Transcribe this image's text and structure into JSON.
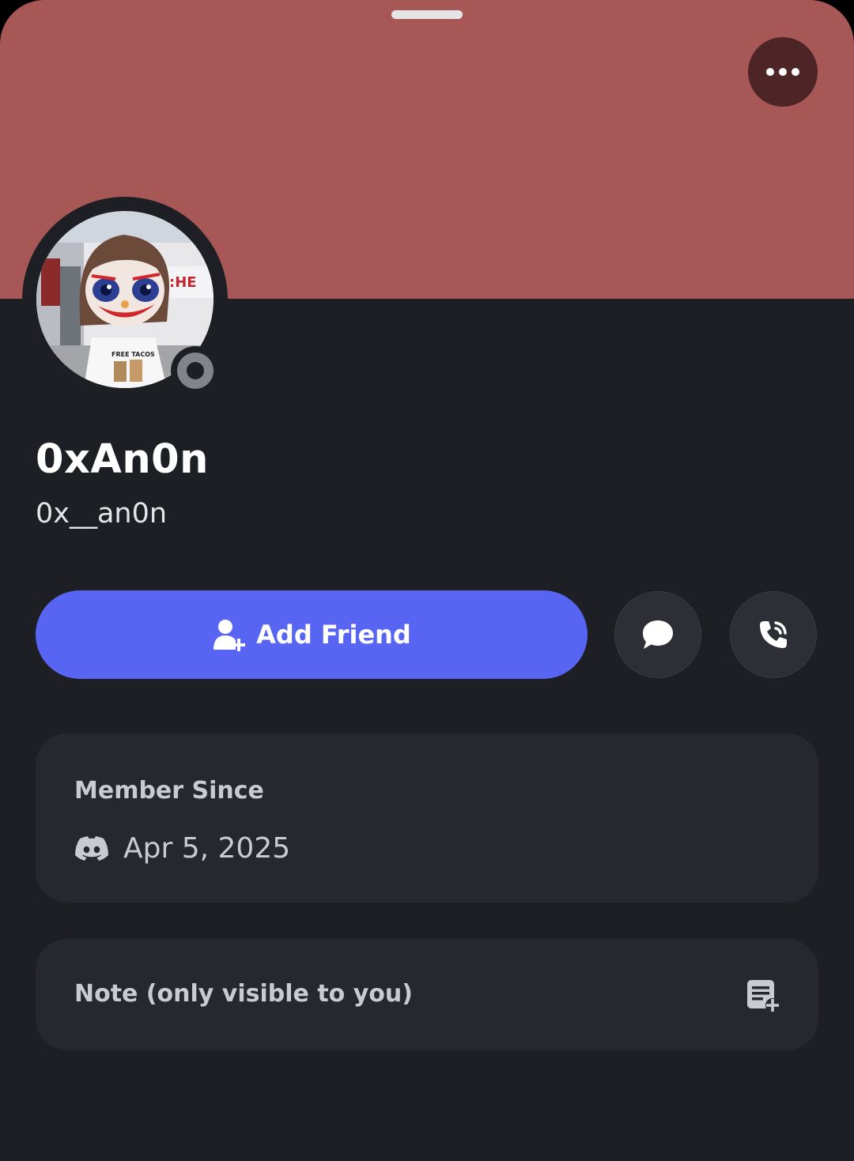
{
  "colors": {
    "banner": "#a85757",
    "sheet_background": "#1e1f24",
    "card_background": "#27282f",
    "primary_button": "#5865f2",
    "status_offline": "#83838b"
  },
  "profile": {
    "display_name": "0xAn0n",
    "username": "0x__an0n",
    "status": "offline",
    "avatar_icon": "cartoon-avatar-image"
  },
  "actions": {
    "add_friend_label": "Add Friend",
    "add_friend_icon": "add-friend-icon",
    "message_icon": "chat-bubble-icon",
    "call_icon": "phone-call-icon",
    "more_icon": "ellipsis-icon"
  },
  "member_since": {
    "title": "Member Since",
    "icon": "discord-logo-icon",
    "date": "Apr 5, 2025"
  },
  "note": {
    "label": "Note (only visible to you)",
    "icon": "add-note-icon"
  }
}
